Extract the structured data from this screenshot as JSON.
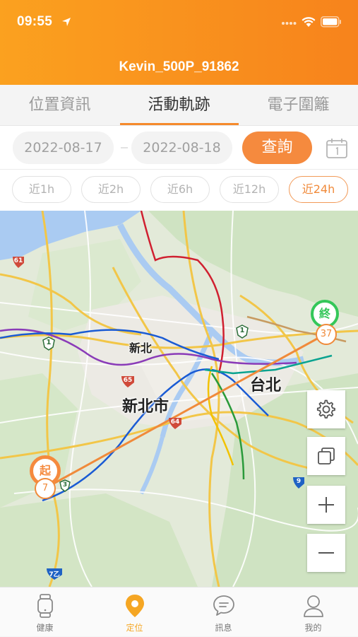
{
  "status_bar": {
    "time": "09:55"
  },
  "header": {
    "device_name": "Kevin_500P_91862"
  },
  "tabs": [
    {
      "label": "位置資訊"
    },
    {
      "label": "活動軌跡"
    },
    {
      "label": "電子圍籬"
    }
  ],
  "query": {
    "start_date": "2022-08-17",
    "end_date": "2022-08-18",
    "query_label": "查詢"
  },
  "quick_filters": [
    {
      "label": "近1h"
    },
    {
      "label": "近2h"
    },
    {
      "label": "近6h"
    },
    {
      "label": "近12h"
    },
    {
      "label": "近24h"
    }
  ],
  "map": {
    "labels": {
      "xinbei_small": "新北",
      "xinbei_city": "新北市",
      "taipei": "台北"
    },
    "route_badges": [
      "61",
      "1",
      "1",
      "65",
      "64",
      "3",
      "9",
      "7乙"
    ],
    "start_marker": {
      "label": "起",
      "count": "7"
    },
    "end_marker": {
      "label": "終",
      "count": "37"
    },
    "accent_color": "#f58a3e",
    "end_color": "#34c759"
  },
  "bottom_nav": [
    {
      "label": "健康",
      "icon": "watch-icon"
    },
    {
      "label": "定位",
      "icon": "location-pin-icon"
    },
    {
      "label": "訊息",
      "icon": "chat-bubble-icon"
    },
    {
      "label": "我的",
      "icon": "person-icon"
    }
  ]
}
